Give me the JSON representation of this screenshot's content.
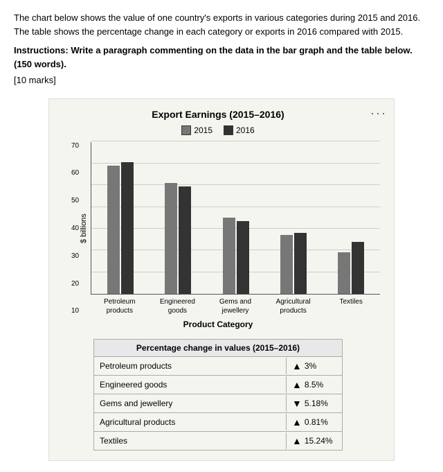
{
  "description": "The chart below shows the value of one country's exports in various categories during 2015 and 2016. The table shows the percentage change in each category or exports in 2016 compared with 2015.",
  "instructions": "Instructions: Write a paragraph commenting on the data in the bar graph and the table below. (150 words).",
  "marks": "[10 marks]",
  "chart": {
    "title": "Export Earnings (2015–2016)",
    "y_axis_label": "$ billions",
    "x_axis_title": "Product Category",
    "legend": {
      "item1": "2015",
      "item2": "2016"
    },
    "y_ticks": [
      "70",
      "60",
      "50",
      "40",
      "30",
      "20",
      "10"
    ],
    "categories": [
      {
        "name": "Petroleum\nproducts",
        "bar_2015_height": 185,
        "bar_2016_height": 190
      },
      {
        "name": "Engineered\ngoods",
        "bar_2015_height": 160,
        "bar_2016_height": 155
      },
      {
        "name": "Gems and\njewellery",
        "bar_2015_height": 110,
        "bar_2016_height": 105
      },
      {
        "name": "Agricultural\nproducts",
        "bar_2015_height": 85,
        "bar_2016_height": 88
      },
      {
        "name": "Textiles",
        "bar_2015_height": 60,
        "bar_2016_height": 75
      }
    ]
  },
  "table": {
    "header": "Percentage change in values (2015–2016)",
    "rows": [
      {
        "category": "Petroleum products",
        "direction": "up",
        "value": "3%"
      },
      {
        "category": "Engineered goods",
        "direction": "up",
        "value": "8.5%"
      },
      {
        "category": "Gems and jewellery",
        "direction": "down",
        "value": "5.18%"
      },
      {
        "category": "Agricultural products",
        "direction": "up",
        "value": "0.81%"
      },
      {
        "category": "Textiles",
        "direction": "up",
        "value": "15.24%"
      }
    ]
  }
}
